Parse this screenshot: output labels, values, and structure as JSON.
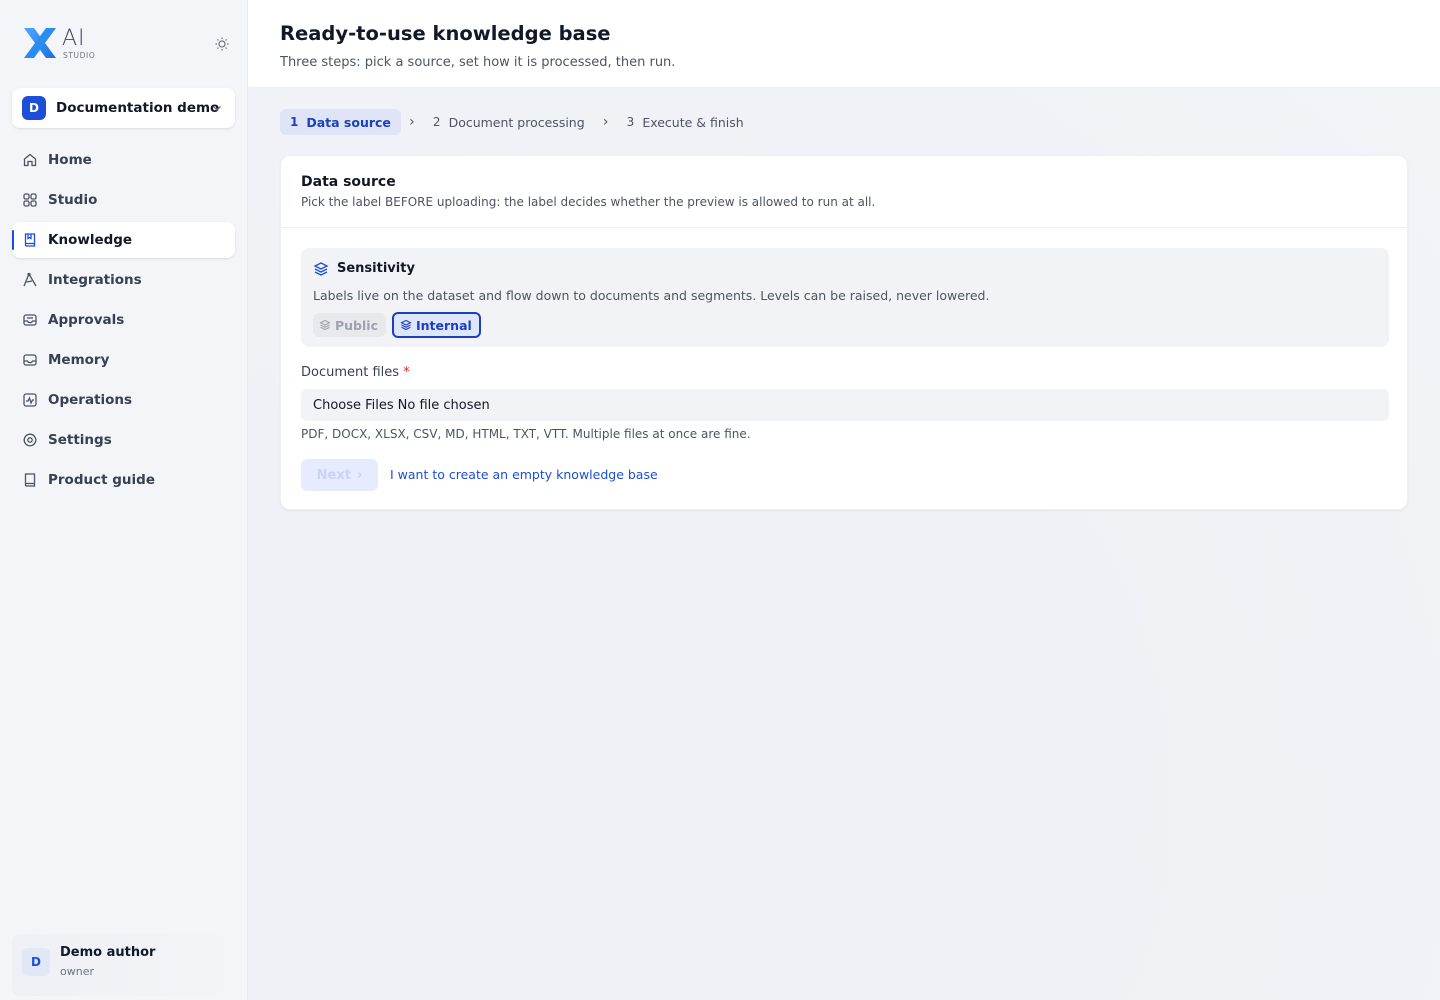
{
  "brand": {
    "logo_text": "AI",
    "logo_sub": "STUDIO"
  },
  "workspace": {
    "initial": "D",
    "name": "Documentation demo"
  },
  "nav": [
    {
      "label": "Home",
      "icon": "home-icon"
    },
    {
      "label": "Studio",
      "icon": "grid-icon"
    },
    {
      "label": "Knowledge",
      "icon": "book-icon",
      "active": true
    },
    {
      "label": "Integrations",
      "icon": "plug-icon"
    },
    {
      "label": "Approvals",
      "icon": "inbox-icon"
    },
    {
      "label": "Memory",
      "icon": "archive-icon"
    },
    {
      "label": "Operations",
      "icon": "activity-icon"
    },
    {
      "label": "Settings",
      "icon": "gear-icon"
    },
    {
      "label": "Product guide",
      "icon": "guide-icon"
    }
  ],
  "user": {
    "initial": "D",
    "name": "Demo author",
    "role": "owner"
  },
  "page": {
    "title": "Ready-to-use knowledge base",
    "subtitle": "Three steps: pick a source, set how it is processed, then run."
  },
  "steps": [
    {
      "num": "1",
      "label": "Data source",
      "active": true
    },
    {
      "num": "2",
      "label": "Document processing"
    },
    {
      "num": "3",
      "label": "Execute & finish"
    }
  ],
  "step_separator": "›",
  "card": {
    "title": "Data source",
    "description": "Pick the label BEFORE uploading: the label decides whether the preview is allowed to run at all."
  },
  "sensitivity": {
    "title": "Sensitivity",
    "description": "Labels live on the dataset and flow down to documents and segments. Levels can be raised, never lowered.",
    "options": [
      {
        "label": "Public",
        "selected": false
      },
      {
        "label": "Internal",
        "selected": true
      }
    ]
  },
  "files": {
    "label": "Document files",
    "required_mark": "*",
    "choose_label": "Choose Files",
    "status": "No file chosen",
    "hint": "PDF, DOCX, XLSX, CSV, MD, HTML, TXT, VTT. Multiple files at once are fine."
  },
  "actions": {
    "next_label": "Next",
    "next_chevron": "›",
    "empty_link": "I want to create an empty knowledge base"
  },
  "colors": {
    "accent": "#1d4ed8",
    "required": "#dc2626"
  }
}
